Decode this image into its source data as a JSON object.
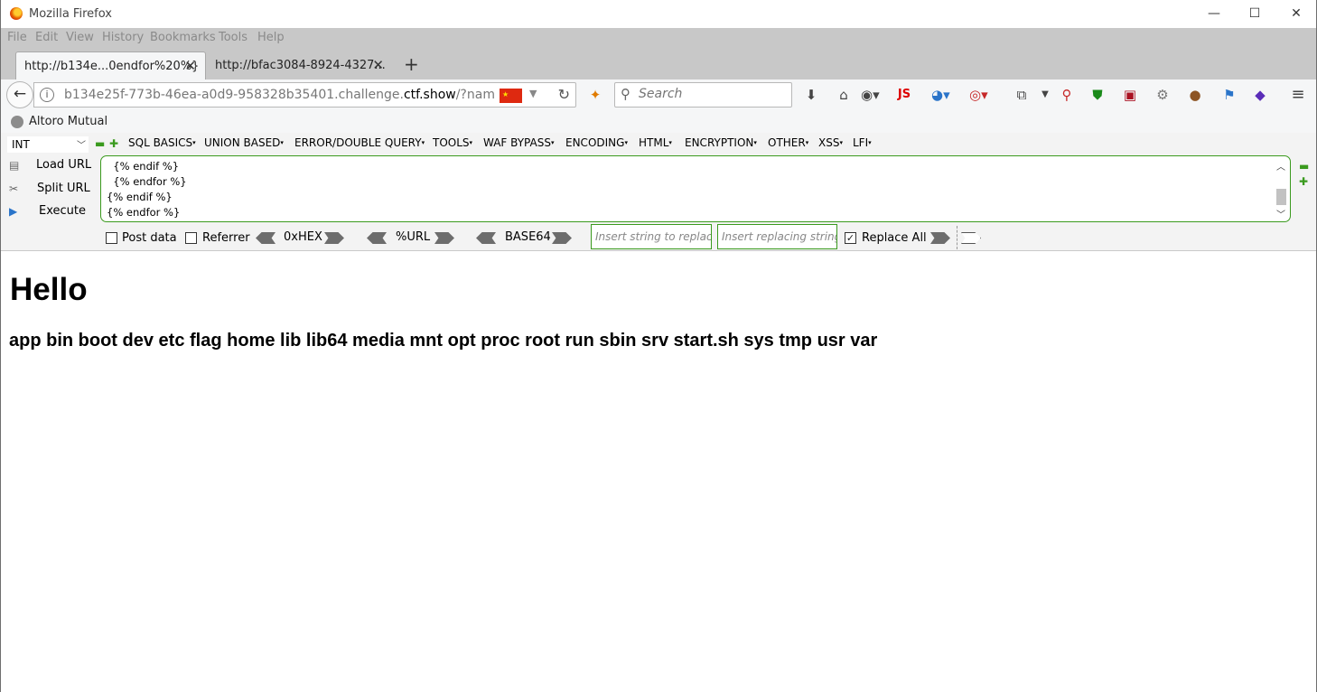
{
  "window": {
    "title": "Mozilla Firefox"
  },
  "menu": {
    "items": [
      "File",
      "Edit",
      "View",
      "History",
      "Bookmarks",
      "Tools",
      "Help"
    ]
  },
  "tabs": [
    {
      "title": "http://b134e...0endfor%20%}",
      "active": true
    },
    {
      "title": "http://bfac3084-8924-4327...",
      "active": false
    }
  ],
  "navbar": {
    "url_prefix": "b134e25f-773b-46ea-a0d9-958328b35401.challenge.",
    "url_domain": "ctf.show",
    "url_suffix": "/?name={%",
    "search_placeholder": "Search",
    "js_label": "JS"
  },
  "bookmarks": {
    "items": [
      "Altoro Mutual"
    ]
  },
  "hackbar": {
    "type_select": "INT",
    "menus": [
      "SQL BASICS",
      "UNION BASED",
      "ERROR/DOUBLE QUERY",
      "TOOLS",
      "WAF BYPASS",
      "ENCODING",
      "HTML",
      "ENCRYPTION",
      "OTHER",
      "XSS",
      "LFI"
    ],
    "actions": [
      "Load URL",
      "Split URL",
      "Execute"
    ],
    "textarea_lines": [
      "  {% endif %}",
      "  {% endfor %}",
      "{% endif %}",
      "{% endfor %}"
    ],
    "post_data_label": "Post data",
    "referrer_label": "Referrer",
    "encoders": [
      "0xHEX",
      "%URL",
      "BASE64"
    ],
    "replace_placeholder": "Insert string to replace",
    "replacing_placeholder": "Insert replacing string",
    "replace_all_label": "Replace All",
    "replace_all_checked": true
  },
  "page": {
    "heading": "Hello",
    "output": "app bin boot dev etc flag home lib lib64 media mnt opt proc root run sbin srv start.sh sys tmp usr var"
  },
  "colors": {
    "accent_green": "#3a9a1e",
    "chrome_gray": "#c8c8c8",
    "toolbar_bg": "#f5f6f7"
  }
}
